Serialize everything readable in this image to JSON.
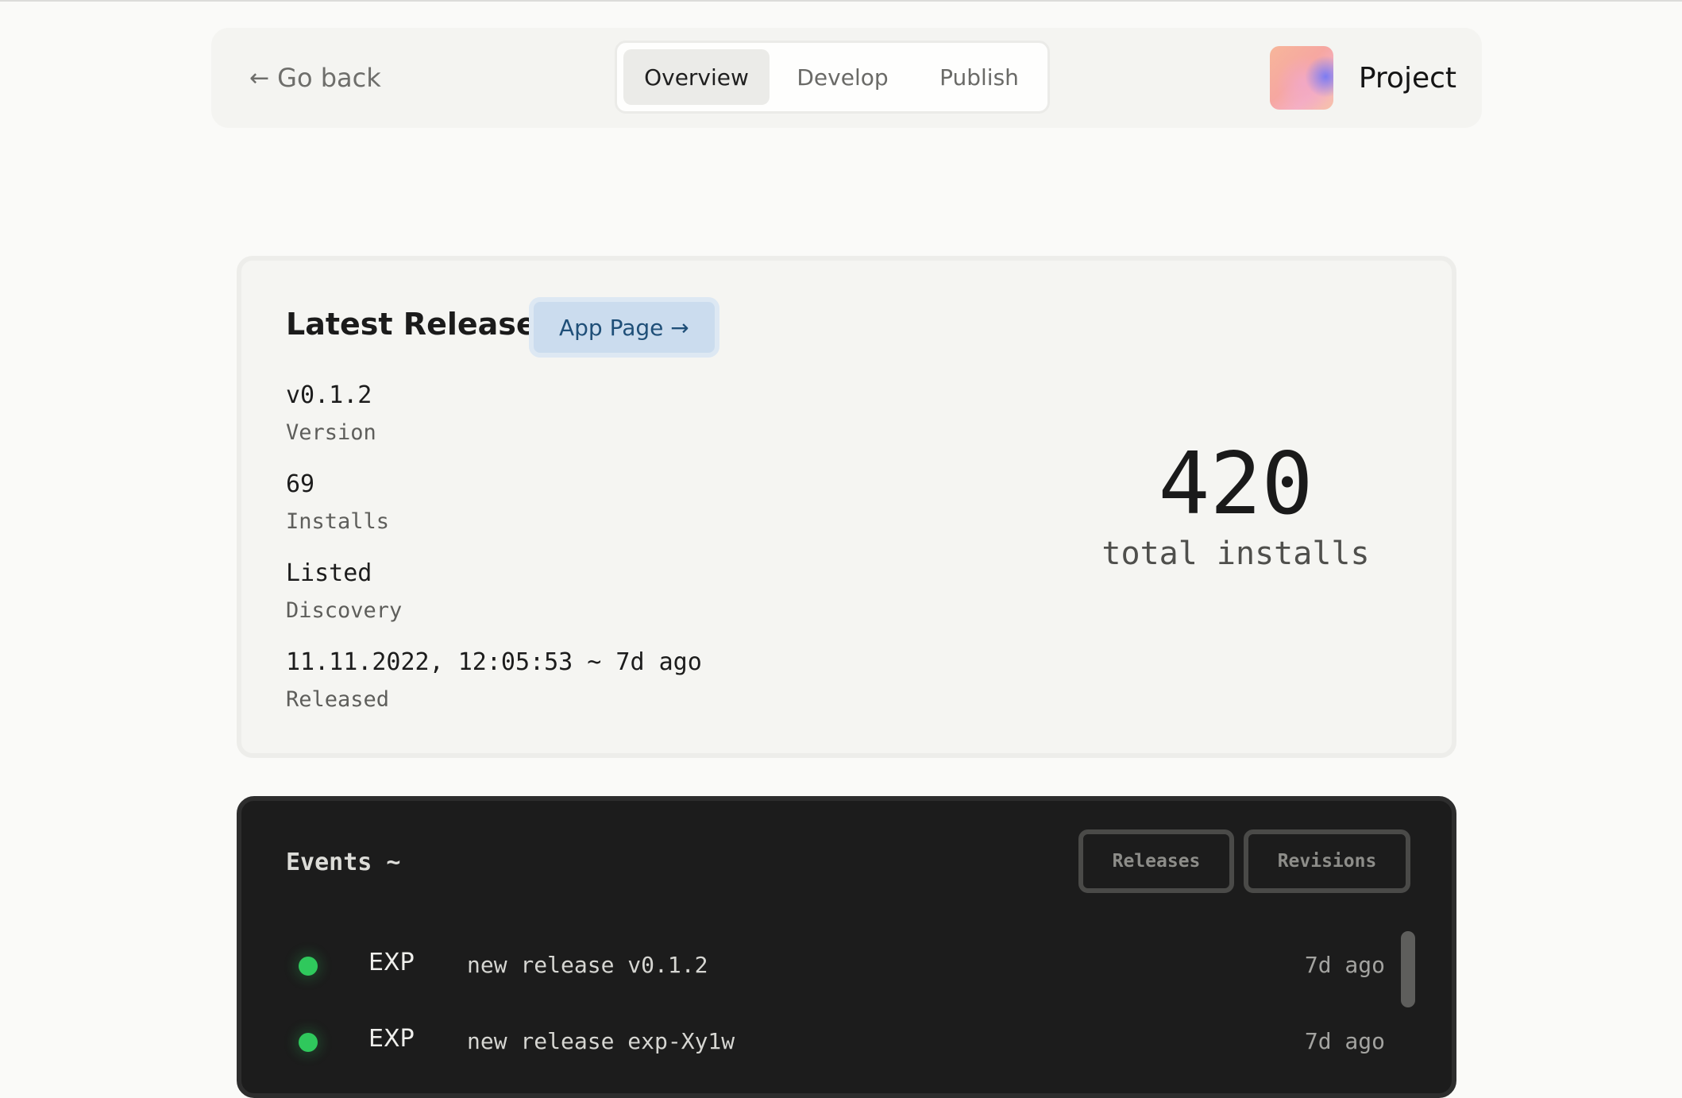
{
  "header": {
    "go_back_arrow": "←",
    "go_back_label": "Go back",
    "tabs": [
      {
        "label": "Overview",
        "active": true
      },
      {
        "label": "Develop",
        "active": false
      },
      {
        "label": "Publish",
        "active": false
      }
    ],
    "project_name": "Project"
  },
  "release": {
    "title": "Latest Release",
    "app_page_label": "App Page →",
    "fields": [
      {
        "value": "v0.1.2",
        "label": "Version"
      },
      {
        "value": "69",
        "label": "Installs"
      },
      {
        "value": "Listed",
        "label": "Discovery"
      },
      {
        "value": "11.11.2022, 12:05:53 ~ 7d ago",
        "label": "Released"
      }
    ],
    "total_installs": "420",
    "total_label": "total installs"
  },
  "events": {
    "title": "Events ~",
    "filters": [
      "Releases",
      "Revisions"
    ],
    "items": [
      {
        "type": "EXP",
        "message": "new release v0.1.2",
        "time": "7d ago",
        "status_color": "#2fc85c"
      },
      {
        "type": "EXP",
        "message": "new release exp-Xy1w",
        "time": "7d ago",
        "status_color": "#2fc85c"
      }
    ]
  }
}
